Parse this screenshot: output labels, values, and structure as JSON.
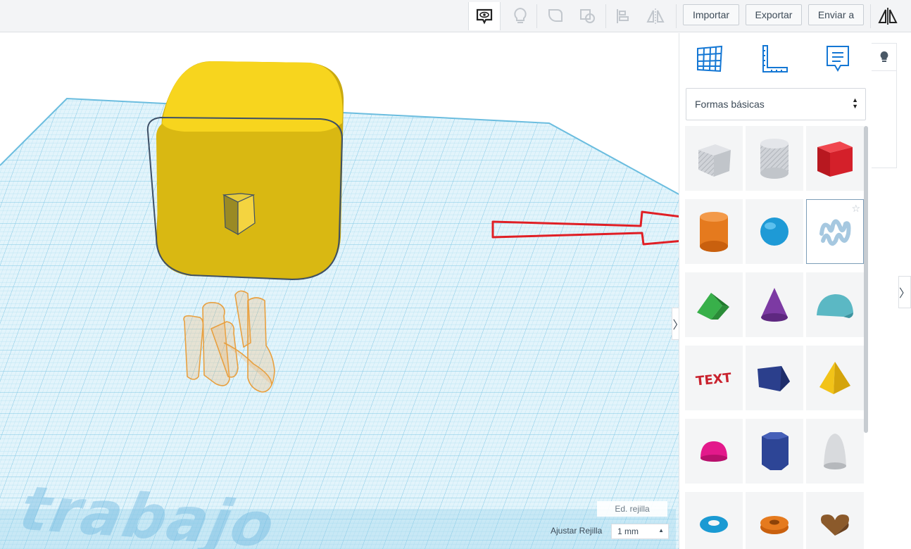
{
  "toolbar": {
    "import_label": "Importar",
    "export_label": "Exportar",
    "send_label": "Enviar a",
    "icons": [
      "notes-eye-icon",
      "lightbulb-icon",
      "group-icon",
      "ungroup-icon",
      "align-icon",
      "mirror-icon"
    ]
  },
  "panel": {
    "tabs": [
      "workplane-grid-icon",
      "ruler-icon",
      "notes-icon"
    ],
    "category": "Formas básicas",
    "shapes": [
      {
        "name": "box-hole",
        "color": "#c9ccd1"
      },
      {
        "name": "cylinder-hole",
        "color": "#c9ccd1"
      },
      {
        "name": "box",
        "color": "#d4202a"
      },
      {
        "name": "cylinder",
        "color": "#e57a1e"
      },
      {
        "name": "sphere",
        "color": "#1e9ad6"
      },
      {
        "name": "scribble",
        "color": "#a6c8e0"
      },
      {
        "name": "roof",
        "color": "#2f9c3d"
      },
      {
        "name": "cone",
        "color": "#7c3aa3"
      },
      {
        "name": "round-roof",
        "color": "#5bb8c4"
      },
      {
        "name": "text",
        "color": "#c9222e"
      },
      {
        "name": "wedge",
        "color": "#2b3f8c"
      },
      {
        "name": "pyramid",
        "color": "#f2c318"
      },
      {
        "name": "half-sphere",
        "color": "#e3198b"
      },
      {
        "name": "polygon",
        "color": "#2d4596"
      },
      {
        "name": "paraboloid",
        "color": "#d8dadd"
      },
      {
        "name": "torus",
        "color": "#1a9ad3"
      },
      {
        "name": "tube",
        "color": "#e57a1e"
      },
      {
        "name": "heart",
        "color": "#8b5a2b"
      }
    ]
  },
  "workplane": {
    "watermark": "trabajo",
    "grid_edit_label": "Ed. rejilla",
    "snap_label": "Ajustar Rejilla",
    "snap_value": "1 mm"
  },
  "colors": {
    "accent": "#1477d4",
    "grid": "#8fd0ea",
    "yellow_box": "#f5cf1c",
    "annotation_arrow": "#e01f25"
  }
}
